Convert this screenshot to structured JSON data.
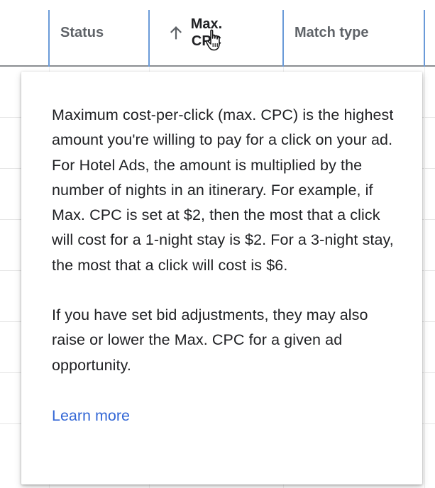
{
  "table": {
    "columns": {
      "status": "Status",
      "max_cpc_line1": "Max.",
      "max_cpc_line2": "CPC",
      "match_type": "Match type"
    },
    "sort": {
      "column": "max_cpc",
      "direction": "ascending",
      "icon": "arrow-up-icon"
    }
  },
  "tooltip": {
    "paragraph1": "Maximum cost-per-click (max. CPC) is the highest amount you're willing to pay for a click on your ad. For Hotel Ads, the amount is multiplied by the number of nights in an itinerary. For example, if Max. CPC is set at $2, then the most that a click will cost for a 1-night stay is $2. For a 3-night stay, the most that a click will cost is $6.",
    "paragraph2": "If you have set bid adjustments, they may also raise or lower the Max. CPC for a given ad opportunity.",
    "learn_more": "Learn more"
  },
  "colors": {
    "divider": "#6a9ad8",
    "link": "#3367d6",
    "header_text": "#5f6368",
    "body_text": "#202124"
  },
  "icons": {
    "cursor": "hand-pointer-icon"
  }
}
